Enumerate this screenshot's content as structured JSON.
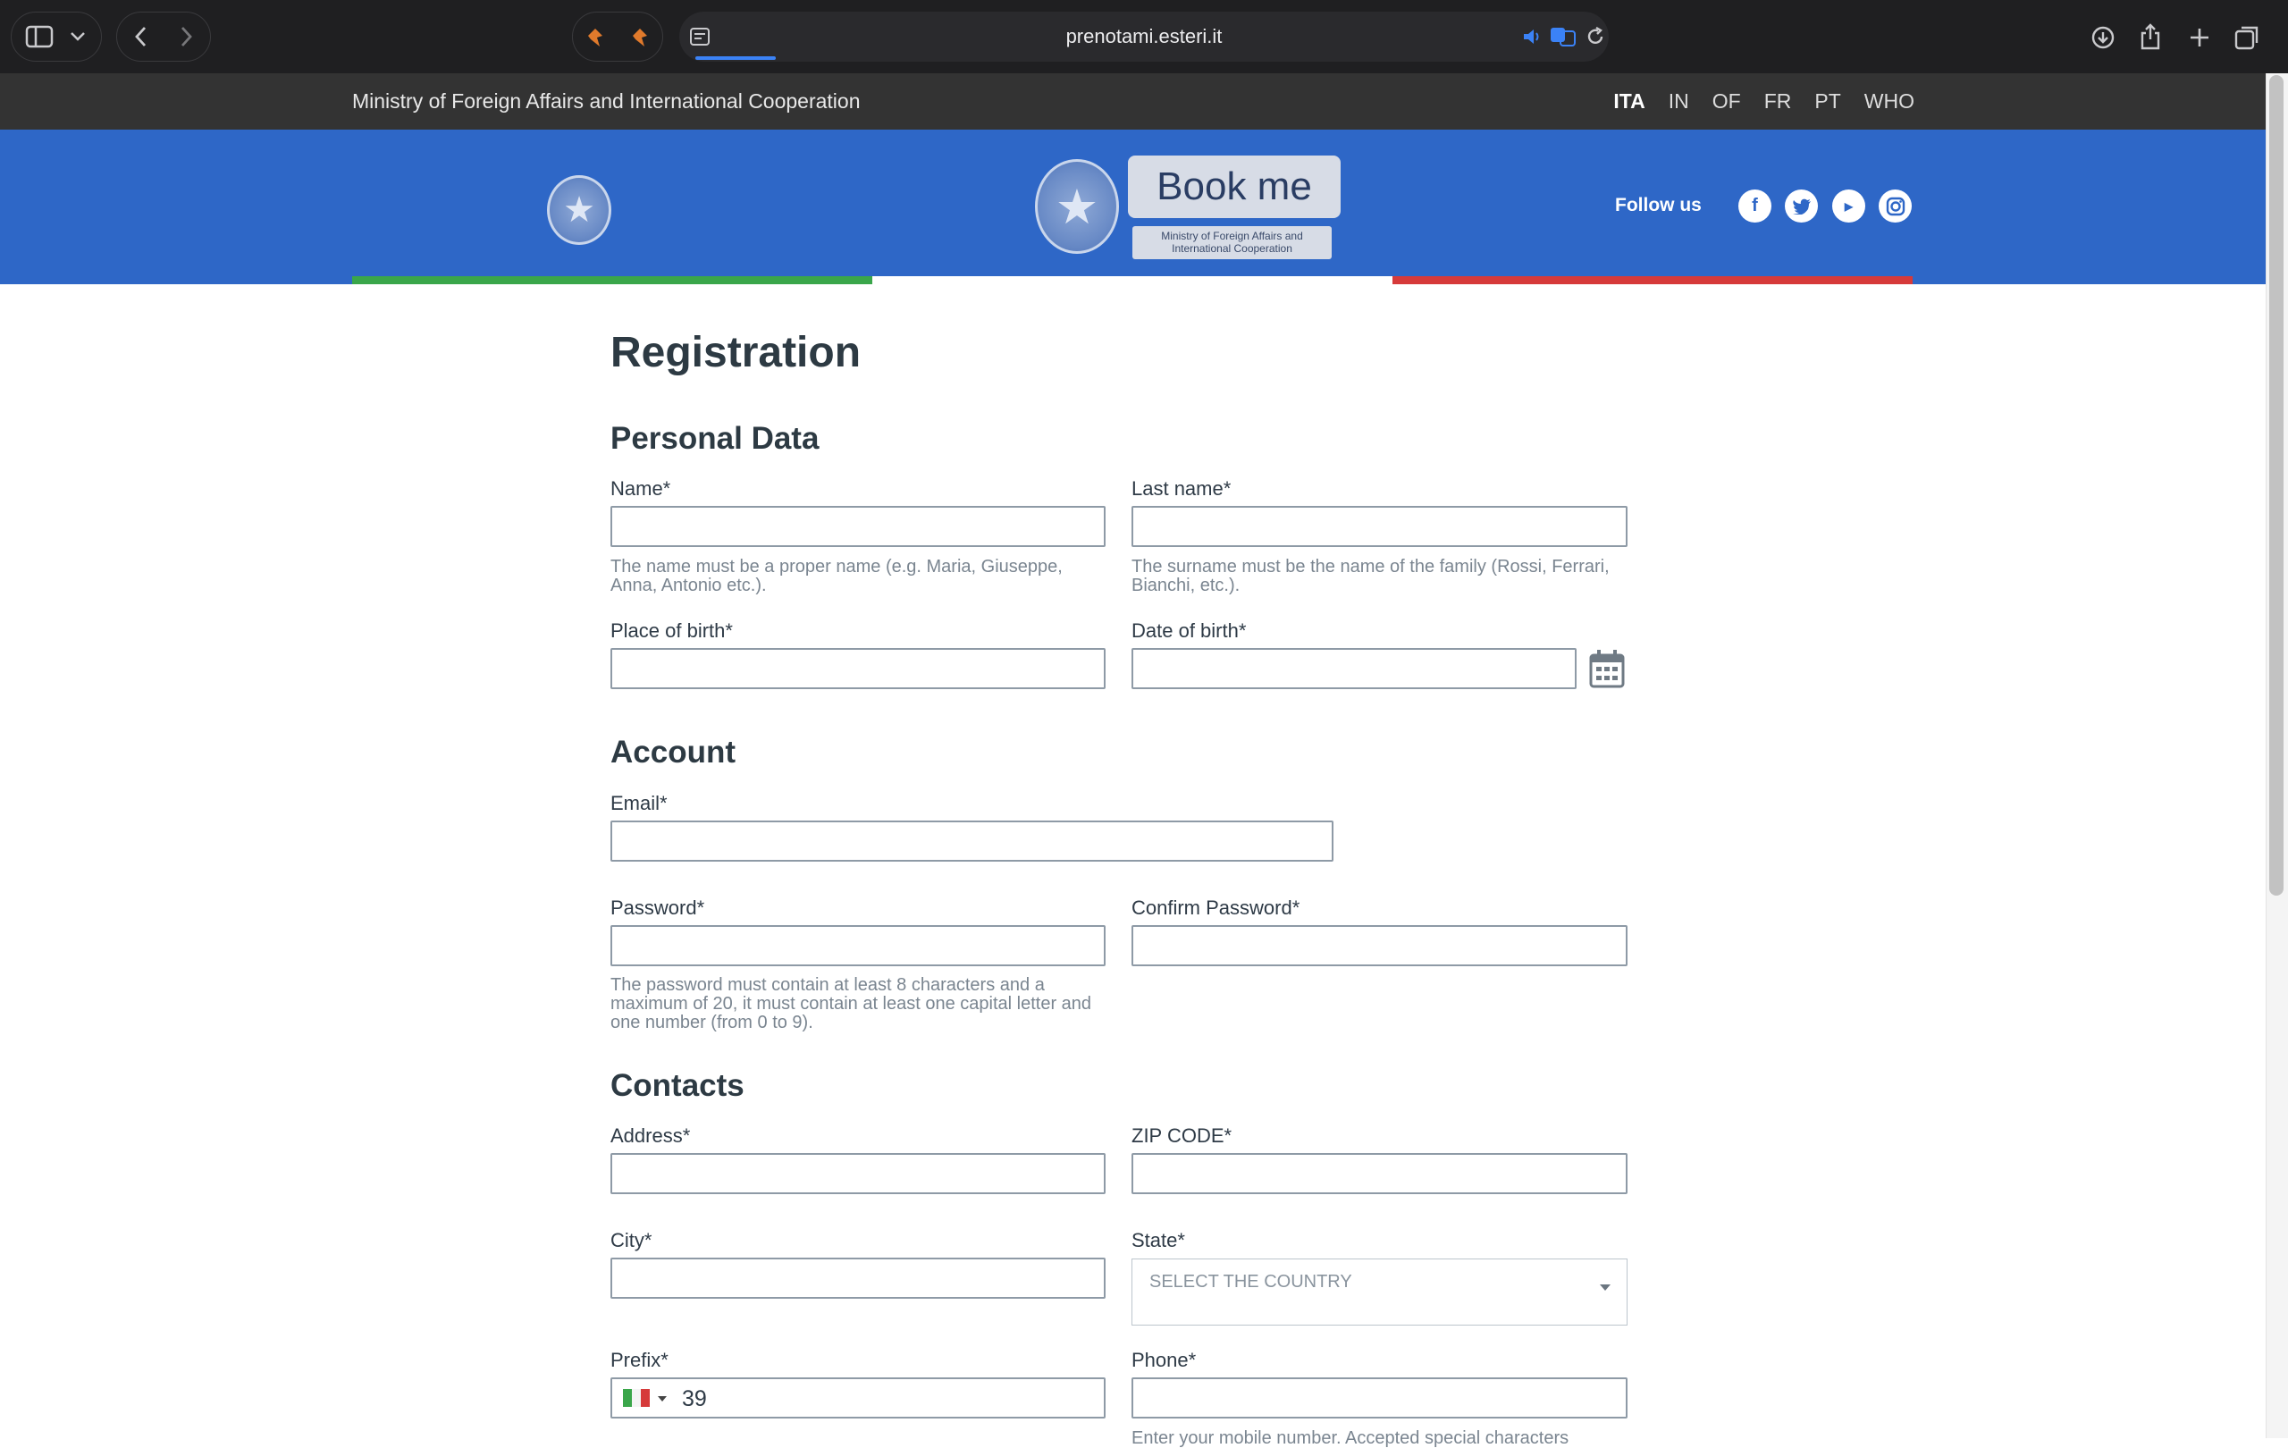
{
  "browser": {
    "url": "prenotami.esteri.it"
  },
  "site": {
    "ministry": "Ministry of Foreign Affairs and International Cooperation",
    "languages": [
      "ITA",
      "IN",
      "OF",
      "FR",
      "PT",
      "WHO"
    ],
    "active_language": "ITA",
    "logo_title": "Book me",
    "logo_subtitle": "Ministry of Foreign Affairs and International Cooperation",
    "follow_label": "Follow us",
    "social": [
      "facebook-icon",
      "twitter-icon",
      "youtube-icon",
      "instagram-icon"
    ],
    "flag_colors": [
      "#3aa64a",
      "#ffffff",
      "#d63a3a"
    ],
    "accent": "#2e67c7"
  },
  "form": {
    "title": "Registration",
    "sections": {
      "personal": "Personal Data",
      "account": "Account",
      "contacts": "Contacts"
    },
    "fields": {
      "name": "Name*",
      "name_hint": "The name must be a proper name (e.g. Maria, Giuseppe, Anna, Antonio etc.).",
      "last_name": "Last name*",
      "last_name_hint": "The surname must be the name of the family (Rossi, Ferrari, Bianchi, etc.).",
      "place_of_birth": "Place of birth*",
      "date_of_birth": "Date of birth*",
      "email": "Email*",
      "password": "Password*",
      "password_hint": "The password must contain at least 8 characters and a maximum of 20, it must contain at least one capital letter and one number (from 0 to 9).",
      "confirm_password": "Confirm Password*",
      "address": "Address*",
      "zip": "ZIP CODE*",
      "city": "City*",
      "state": "State*",
      "state_value": "SELECT THE COUNTRY",
      "prefix": "Prefix*",
      "prefix_value": "39",
      "phone": "Phone*",
      "phone_hint": "Enter your mobile number. Accepted special characters"
    }
  }
}
